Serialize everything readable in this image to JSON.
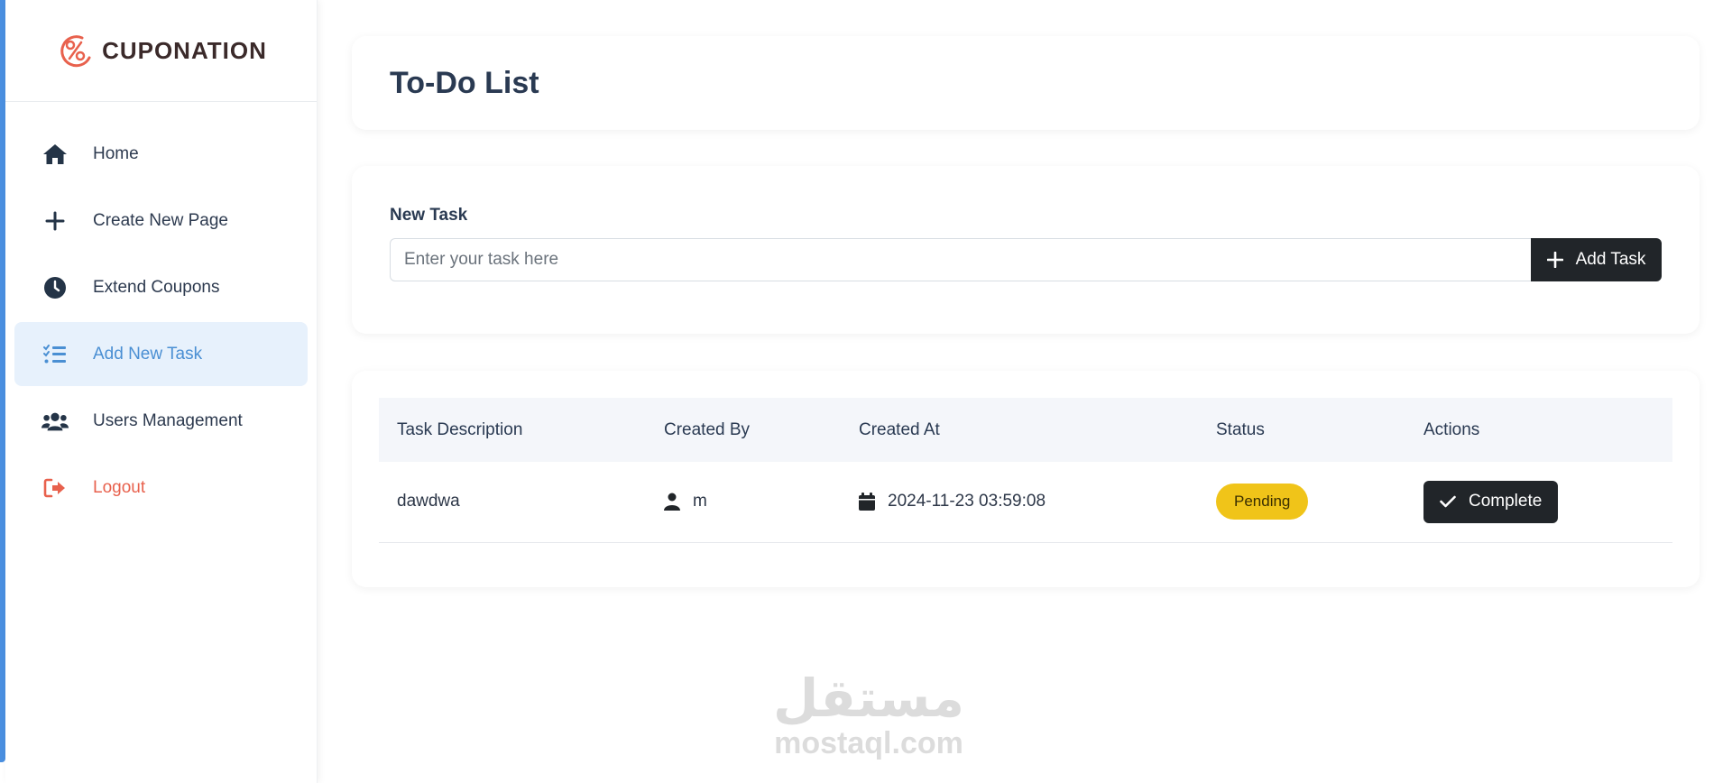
{
  "brand": {
    "name": "CUPONATION",
    "logo_icon": "percent-logo-icon",
    "logo_color": "#e8614d"
  },
  "sidebar": {
    "items": [
      {
        "label": "Home",
        "icon": "home-icon",
        "active": false
      },
      {
        "label": "Create New Page",
        "icon": "plus-icon",
        "active": false
      },
      {
        "label": "Extend Coupons",
        "icon": "clock-icon",
        "active": false
      },
      {
        "label": "Add New Task",
        "icon": "task-list-icon",
        "active": true
      },
      {
        "label": "Users Management",
        "icon": "users-icon",
        "active": false
      },
      {
        "label": "Logout",
        "icon": "logout-icon",
        "active": false
      }
    ]
  },
  "page": {
    "title": "To-Do List"
  },
  "form": {
    "label": "New Task",
    "placeholder": "Enter your task here",
    "value": "",
    "add_button_label": "Add Task"
  },
  "table": {
    "headers": [
      "Task Description",
      "Created By",
      "Created At",
      "Status",
      "Actions"
    ],
    "rows": [
      {
        "description": "dawdwa",
        "created_by": "m",
        "created_at": "2024-11-23 03:59:08",
        "status": "Pending",
        "action_label": "Complete"
      }
    ]
  },
  "watermark": {
    "arabic": "مستقل",
    "latin": "mostaql.com"
  },
  "colors": {
    "accent": "#4a8fe0",
    "active_bg": "#e7f1fc",
    "active_text": "#4a8fd3",
    "logout": "#e8614d",
    "dark_button": "#212529",
    "pending_badge": "#f0c419"
  }
}
